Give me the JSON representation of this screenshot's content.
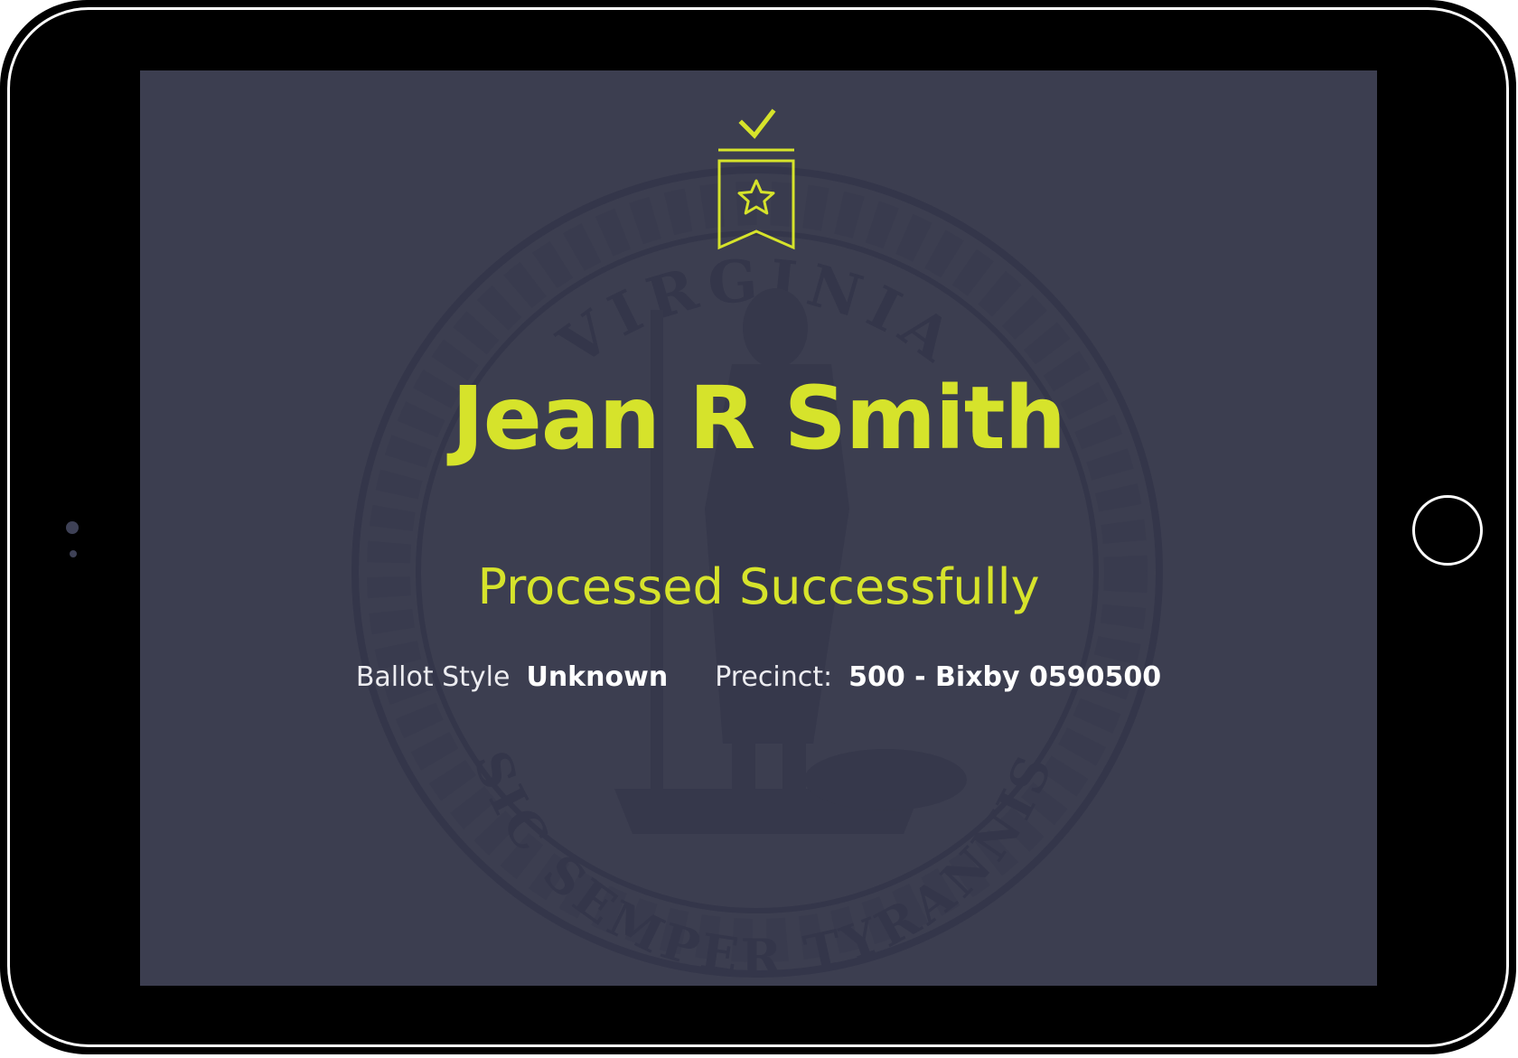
{
  "voter": {
    "name": "Jean R Smith",
    "status": "Processed Successfully"
  },
  "details": {
    "ballot_style_label": "Ballot Style",
    "ballot_style_value": "Unknown",
    "precinct_label": "Precinct:",
    "precinct_value": "500 - Bixby 0590500"
  },
  "seal": {
    "top_text": "VIRGINIA",
    "bottom_text": "SIC SEMPER TYRANNIS"
  },
  "icons": {
    "badge": "check-ribbon-star-icon",
    "home": "home-button-icon"
  },
  "colors": {
    "accent": "#d6e32b",
    "screen_background": "#3c3e50",
    "device_frame": "#000000",
    "text_primary": "#ffffff"
  }
}
